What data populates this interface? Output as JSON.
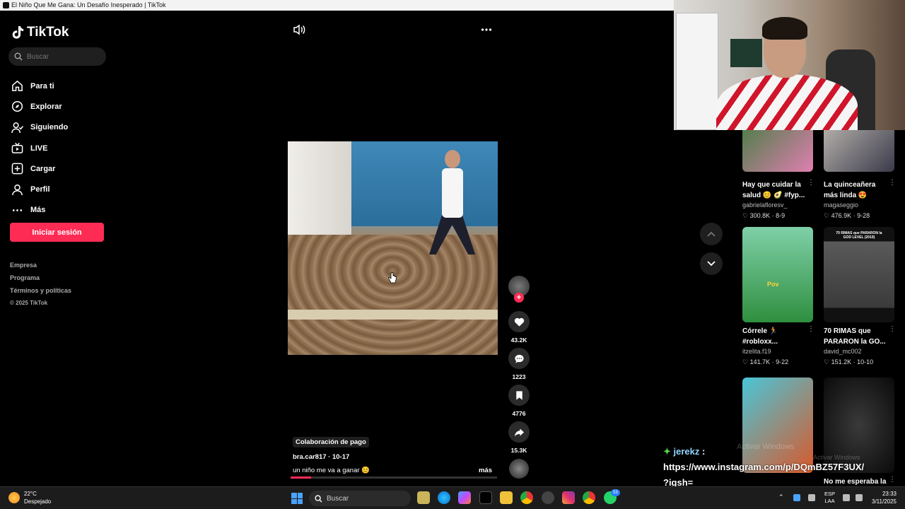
{
  "window": {
    "title": "El Niño Que Me Gana: Un Desafío Inesperado | TikTok"
  },
  "brand": {
    "name": "TikTok",
    "accent": "#fe2c55"
  },
  "search": {
    "placeholder": "Buscar"
  },
  "nav": [
    {
      "label": "Para ti",
      "icon": "home-icon"
    },
    {
      "label": "Explorar",
      "icon": "compass-icon"
    },
    {
      "label": "Siguiendo",
      "icon": "following-icon"
    },
    {
      "label": "LIVE",
      "icon": "live-icon"
    },
    {
      "label": "Cargar",
      "icon": "upload-icon"
    },
    {
      "label": "Perfil",
      "icon": "profile-icon"
    },
    {
      "label": "Más",
      "icon": "more-icon"
    }
  ],
  "login": {
    "label": "Iniciar sesión"
  },
  "footer": {
    "empresa": "Empresa",
    "programa": "Programa",
    "terminos": "Términos y políticas",
    "copyright": "© 2025 TikTok"
  },
  "video": {
    "sponsored": "Colaboración de pago",
    "author": "bra.car817 · 10-17",
    "description": "un niño me va a ganar 😊",
    "more": "más",
    "progress": 0.1,
    "likes": "43.2K",
    "comments": "1223",
    "saves": "4776",
    "shares": "15.3K"
  },
  "recommended": [
    {
      "title": "Hay que cuidar la salud 😊 🥑 #fyp...",
      "user": "gabrielafloresv_",
      "views": "300.8K",
      "date": "8-9",
      "colors": [
        "#3a7d3a",
        "#e07fb0"
      ]
    },
    {
      "title": "La quinceañera más linda 😍",
      "user": "magaseggio",
      "views": "476.9K",
      "date": "9-28",
      "colors": [
        "#c8c2ba",
        "#3a3a4a"
      ]
    },
    {
      "title": "Córrele 🏃 #robloxx...",
      "user": "itzelita.f19",
      "views": "141.7K",
      "date": "9-22",
      "colors": [
        "#7fd0a8",
        "#2f8f3f"
      ]
    },
    {
      "title": "70 RIMAS que PARARON la GO...",
      "user": "david_mc002",
      "views": "151.2K",
      "date": "10-10",
      "colors": [
        "#111111",
        "#5a5a5a"
      ]
    },
    {
      "title": "",
      "user": "",
      "views": "",
      "date": "",
      "colors": [
        "#49c6d8",
        "#d9582a"
      ]
    },
    {
      "title": "No me esperaba la",
      "user": "",
      "views": "",
      "date": "",
      "colors": [
        "#0a0a0a",
        "#3a3a3a"
      ]
    }
  ],
  "thumb_texts": {
    "pov": "Pov",
    "rimas": "70 RIMAS que PARARON la GOD LEVEL (2019)"
  },
  "chat": {
    "user": "jerekz",
    "colon": ":",
    "line1": "https://www.instagram.com/p/DQmBZ57F3UX/",
    "line2": "?igsh="
  },
  "watermark": {
    "line1": "Activar Windows",
    "line2": "Activar Windows"
  },
  "taskbar": {
    "temperature": "22°C",
    "weather": "Despejado",
    "search": "Buscar",
    "lang1": "ESP",
    "lang2": "LAA",
    "time": "23:33",
    "date": "3/11/2025",
    "badge": "53"
  }
}
